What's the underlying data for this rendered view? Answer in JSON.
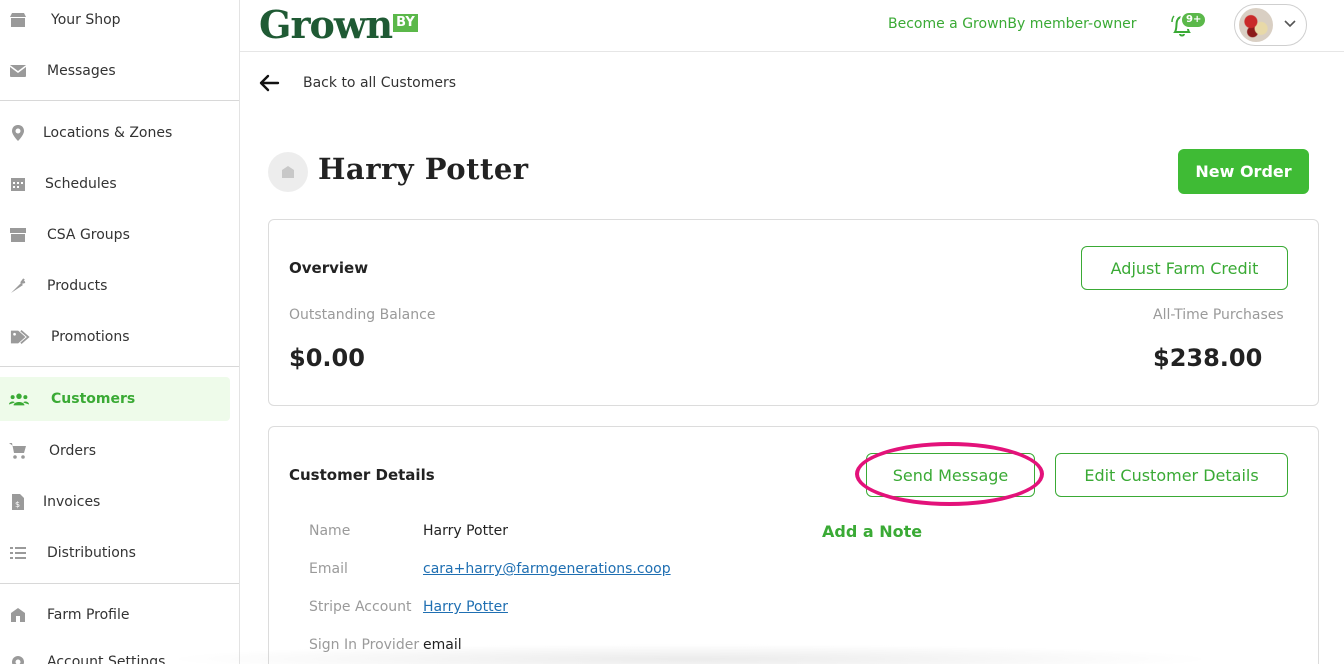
{
  "sidebar": {
    "items": [
      {
        "label": "Your Shop",
        "icon": "storefront-icon"
      },
      {
        "label": "Messages",
        "icon": "envelope-icon"
      },
      {
        "label": "Locations & Zones",
        "icon": "map-pin-icon"
      },
      {
        "label": "Schedules",
        "icon": "calendar-icon"
      },
      {
        "label": "CSA Groups",
        "icon": "box-icon"
      },
      {
        "label": "Products",
        "icon": "carrot-icon"
      },
      {
        "label": "Promotions",
        "icon": "tags-icon"
      },
      {
        "label": "Customers",
        "icon": "users-icon",
        "active": true
      },
      {
        "label": "Orders",
        "icon": "cart-icon"
      },
      {
        "label": "Invoices",
        "icon": "invoice-icon"
      },
      {
        "label": "Distributions",
        "icon": "list-icon"
      },
      {
        "label": "Farm Profile",
        "icon": "barn-icon"
      },
      {
        "label": "Account Settings",
        "icon": "gear-icon"
      }
    ]
  },
  "header": {
    "logo_text": "Grown",
    "logo_badge": "BY",
    "member_link": "Become a GrownBy member-owner",
    "notification_badge": "9+"
  },
  "main": {
    "back_label": "Back to all Customers",
    "customer_name": "Harry Potter",
    "new_order_label": "New Order",
    "overview": {
      "title": "Overview",
      "adjust_credit_label": "Adjust Farm Credit",
      "outstanding_label": "Outstanding Balance",
      "outstanding_value": "$0.00",
      "alltime_label": "All-Time Purchases",
      "alltime_value": "$238.00"
    },
    "details": {
      "title": "Customer Details",
      "send_message_label": "Send Message",
      "edit_label": "Edit Customer Details",
      "add_note_label": "Add a Note",
      "rows": [
        {
          "label": "Name",
          "value": "Harry Potter"
        },
        {
          "label": "Email",
          "value": "cara+harry@farmgenerations.coop"
        },
        {
          "label": "Stripe Account",
          "value": "Harry Potter"
        },
        {
          "label": "Sign In Provider",
          "value": "email"
        }
      ]
    }
  },
  "colors": {
    "brand_green": "#3fbb35",
    "logo_dark_green": "#1f5a34",
    "highlight_pink": "#e3127a",
    "link_blue": "#1f6fb2"
  }
}
